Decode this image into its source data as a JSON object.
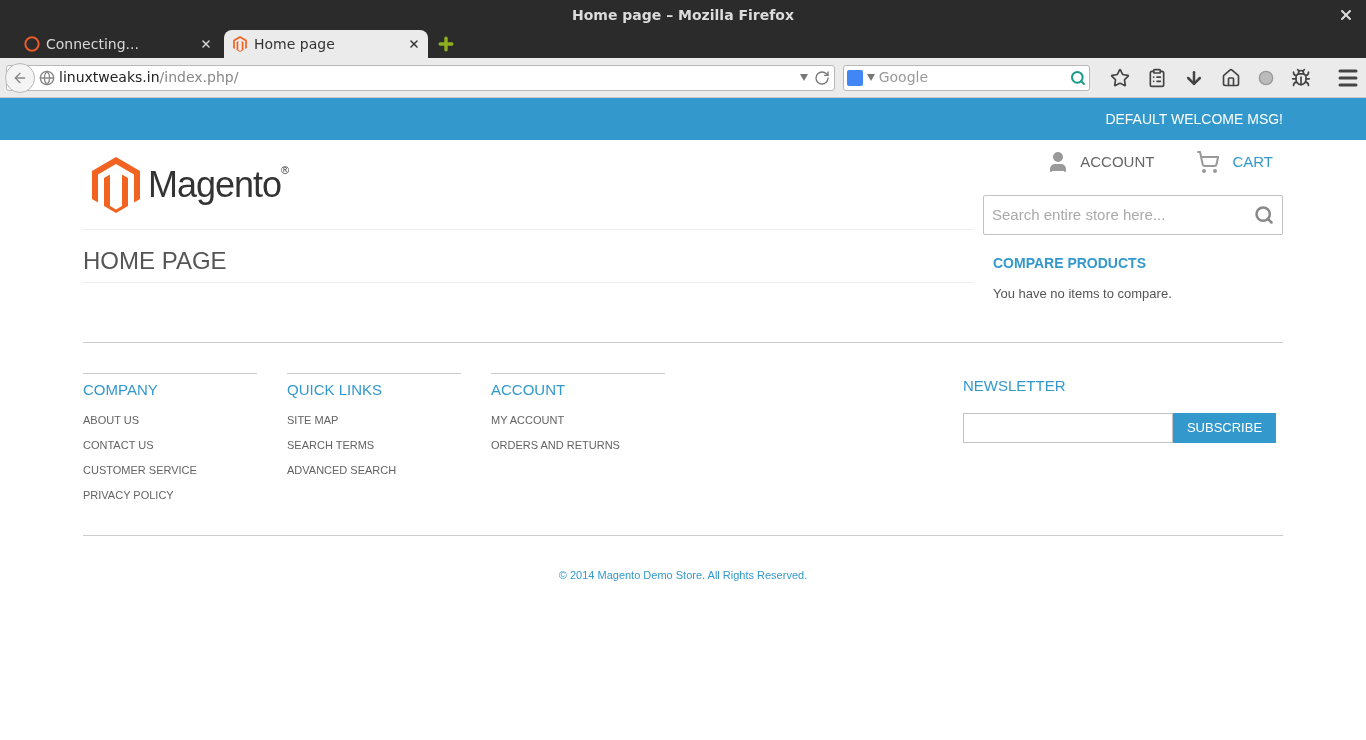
{
  "window": {
    "title": "Home page – Mozilla Firefox"
  },
  "tabs": [
    {
      "label": "Connecting...",
      "kind": "loading",
      "selected": false
    },
    {
      "label": "Home page",
      "kind": "site",
      "selected": true
    }
  ],
  "address_bar": {
    "host": "linuxtweaks.in",
    "path": "/index.php/"
  },
  "search_bar": {
    "placeholder": "Google"
  },
  "top_bar": {
    "welcome": "DEFAULT WELCOME MSG!"
  },
  "header": {
    "logo": {
      "name": "Magento",
      "mark": "®"
    },
    "account": "ACCOUNT",
    "cart": "CART",
    "search": {
      "placeholder": "Search entire store here..."
    }
  },
  "page": {
    "title": "HOME PAGE"
  },
  "sidebar": {
    "title": "COMPARE PRODUCTS",
    "text": "You have no items to compare."
  },
  "footer": {
    "columns": [
      {
        "title": "COMPANY",
        "links": [
          "ABOUT US",
          "CONTACT US",
          "CUSTOMER SERVICE",
          "PRIVACY POLICY"
        ]
      },
      {
        "title": "QUICK LINKS",
        "links": [
          "SITE MAP",
          "SEARCH TERMS",
          "ADVANCED SEARCH"
        ]
      },
      {
        "title": "ACCOUNT",
        "links": [
          "MY ACCOUNT",
          "ORDERS AND RETURNS"
        ]
      }
    ],
    "newsletter": {
      "title": "NEWSLETTER",
      "button": "SUBSCRIBE"
    },
    "copyright": "© 2014 Magento Demo Store. All Rights Reserved."
  }
}
